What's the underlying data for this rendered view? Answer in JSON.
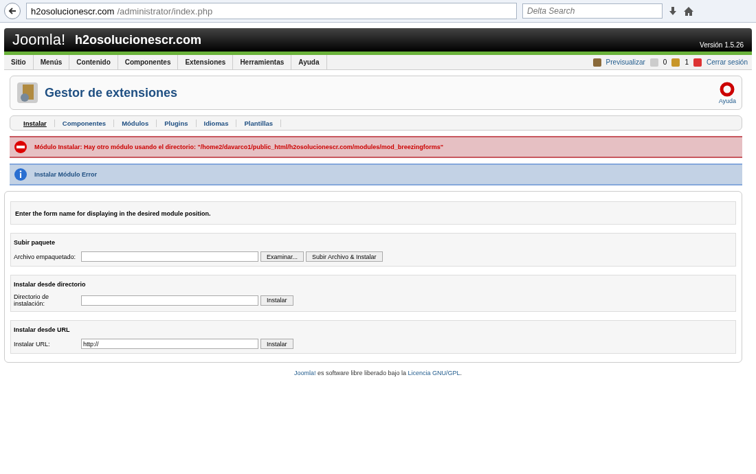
{
  "browser": {
    "url_host": "h2osolucionescr.com",
    "url_path": "/administrator/index.php",
    "search_placeholder": "Delta Search"
  },
  "header": {
    "logo": "Joomla!",
    "site": "h2osolucionescr.com",
    "version": "Versión 1.5.26"
  },
  "menu": [
    "Sitio",
    "Menús",
    "Contenido",
    "Componentes",
    "Extensiones",
    "Herramientas",
    "Ayuda"
  ],
  "status": {
    "preview": "Previsualizar",
    "messages": "0",
    "users": "1",
    "logout": "Cerrar sesión"
  },
  "toolbar": {
    "title": "Gestor de extensiones",
    "help": "Ayuda"
  },
  "tabs": [
    {
      "label": "Instalar",
      "selected": true
    },
    {
      "label": "Componentes",
      "selected": false
    },
    {
      "label": "Módulos",
      "selected": false
    },
    {
      "label": "Plugins",
      "selected": false
    },
    {
      "label": "Idiomas",
      "selected": false
    },
    {
      "label": "Plantillas",
      "selected": false
    }
  ],
  "messages": [
    {
      "kind": "error",
      "text": "Módulo Instalar: Hay otro módulo usando el directorio: \"/home2/davarco1/public_html/h2osolucionescr.com/modules/mod_breezingforms\""
    },
    {
      "kind": "info",
      "text": "Instalar Módulo Error"
    }
  ],
  "notice": "Enter the form name for displaying in the desired module position.",
  "sections": [
    {
      "title": "Subir paquete",
      "label": "Archivo empaquetado:",
      "buttons": [
        "Examinar...",
        "Subir Archivo & Instalar"
      ]
    },
    {
      "title": "Instalar desde directorio",
      "label": "Directorio de instalación:",
      "buttons": [
        "Instalar"
      ]
    },
    {
      "title": "Instalar desde URL",
      "label": "Instalar URL:",
      "value": "http://",
      "buttons": [
        "Instalar"
      ]
    }
  ],
  "footer": [
    {
      "kind": "link",
      "text": "Joomla!"
    },
    {
      "kind": "text",
      "text": " es software libre liberado bajo la "
    },
    {
      "kind": "link",
      "text": "Licencia GNU/GPL"
    },
    {
      "kind": "text",
      "text": "."
    }
  ]
}
